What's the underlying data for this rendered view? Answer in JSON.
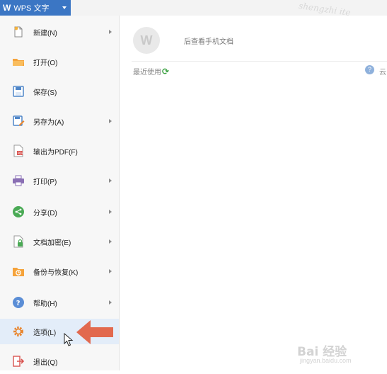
{
  "app": {
    "logo": "W",
    "title": "WPS 文字"
  },
  "menu": {
    "items": [
      {
        "label": "新建(N)",
        "icon": "new-document-icon",
        "submenu": true
      },
      {
        "label": "打开(O)",
        "icon": "open-folder-icon",
        "submenu": false
      },
      {
        "label": "保存(S)",
        "icon": "save-icon",
        "submenu": false
      },
      {
        "label": "另存为(A)",
        "icon": "save-as-icon",
        "submenu": true
      },
      {
        "label": "输出为PDF(F)",
        "icon": "export-pdf-icon",
        "submenu": false
      },
      {
        "label": "打印(P)",
        "icon": "printer-icon",
        "submenu": true
      },
      {
        "label": "分享(D)",
        "icon": "share-icon",
        "submenu": true
      },
      {
        "label": "文档加密(E)",
        "icon": "encrypt-document-icon",
        "submenu": true
      },
      {
        "label": "备份与恢复(K)",
        "icon": "backup-restore-icon",
        "submenu": true
      },
      {
        "label": "帮助(H)",
        "icon": "help-icon",
        "submenu": true
      },
      {
        "label": "选项(L)",
        "icon": "options-gear-icon",
        "submenu": false,
        "highlighted": true
      },
      {
        "label": "退出(Q)",
        "icon": "exit-icon",
        "submenu": false
      }
    ]
  },
  "content": {
    "avatar_letter": "W",
    "phone_hint": "后查看手机文档",
    "recent_label": "最近使用",
    "cloud_label": "云"
  },
  "watermark": {
    "top_text": "shengzhi ite",
    "baidu": "Bai 经验",
    "url": "jingyan.baidu.com"
  },
  "colors": {
    "accent": "#3b76c4",
    "menu_bg": "#f7f7f7",
    "highlight": "#e3edf9",
    "arrow": "#e2694e"
  }
}
